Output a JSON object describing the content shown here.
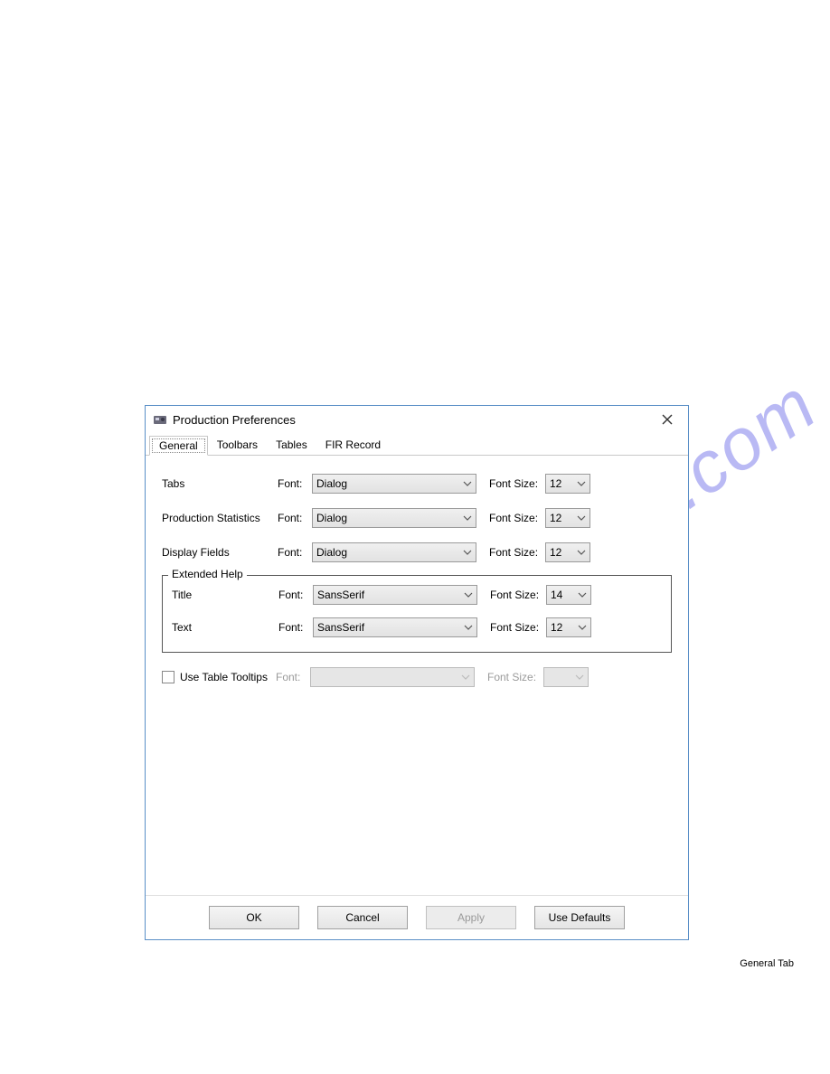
{
  "watermark": "manualshive.com",
  "dialog": {
    "title": "Production Preferences",
    "tabs": [
      "General",
      "Toolbars",
      "Tables",
      "FIR Record"
    ],
    "active_tab": "General",
    "labels": {
      "font": "Font:",
      "font_size": "Font Size:"
    },
    "rows": {
      "tabs": {
        "label": "Tabs",
        "font": "Dialog",
        "size": "12"
      },
      "prodstats": {
        "label": "Production Statistics",
        "font": "Dialog",
        "size": "12"
      },
      "display": {
        "label": "Display Fields",
        "font": "Dialog",
        "size": "12"
      }
    },
    "extended_help": {
      "legend": "Extended Help",
      "title": {
        "label": "Title",
        "font": "SansSerif",
        "size": "14"
      },
      "text": {
        "label": "Text",
        "font": "SansSerif",
        "size": "12"
      }
    },
    "tooltips": {
      "label": "Use Table Tooltips",
      "font": "",
      "size": ""
    },
    "buttons": {
      "ok": "OK",
      "cancel": "Cancel",
      "apply": "Apply",
      "defaults": "Use Defaults"
    }
  },
  "caption": "General Tab"
}
